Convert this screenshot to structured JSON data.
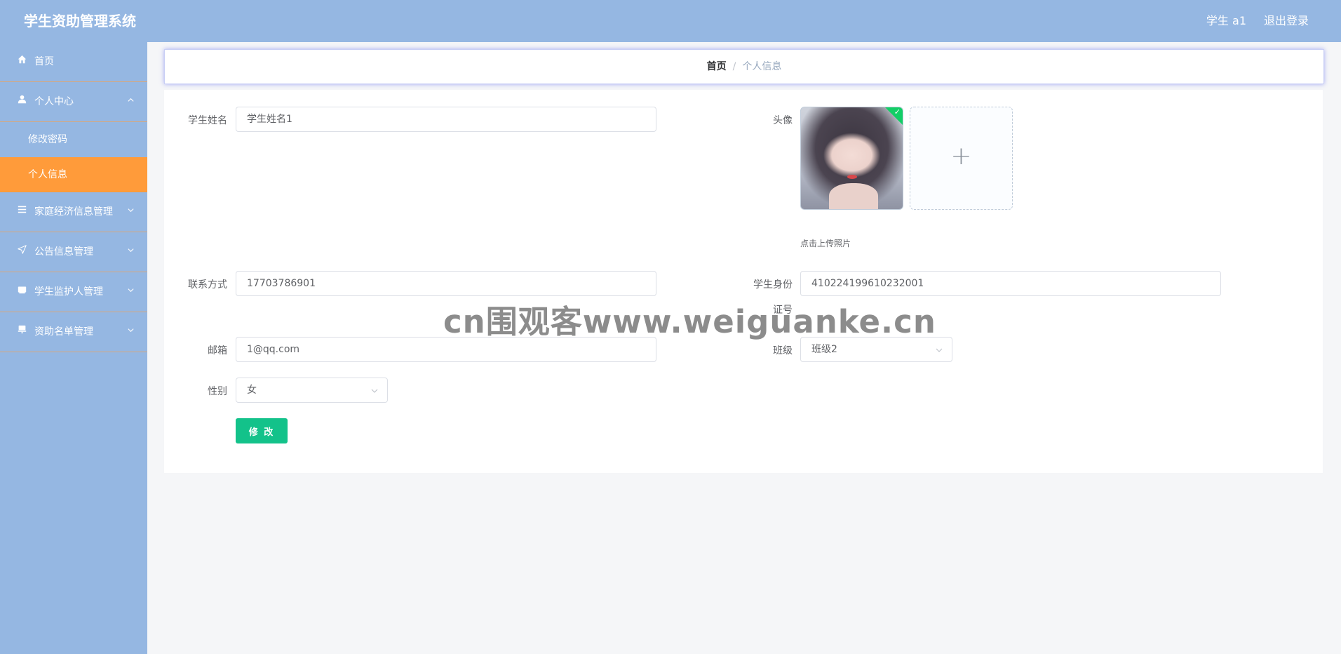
{
  "header": {
    "app_title": "学生资助管理系统",
    "user_name": "学生 a1",
    "logout_label": "退出登录"
  },
  "sidebar": {
    "items": [
      {
        "label": "首页",
        "icon": "home-icon"
      },
      {
        "label": "个人中心",
        "icon": "user-icon",
        "expanded": true,
        "children": [
          {
            "label": "修改密码"
          },
          {
            "label": "个人信息",
            "active": true
          }
        ]
      },
      {
        "label": "家庭经济信息管理",
        "icon": "list-icon"
      },
      {
        "label": "公告信息管理",
        "icon": "send-icon"
      },
      {
        "label": "学生监护人管理",
        "icon": "folder-icon"
      },
      {
        "label": "资助名单管理",
        "icon": "stamp-icon"
      }
    ]
  },
  "breadcrumb": {
    "home": "首页",
    "separator": "/",
    "current": "个人信息"
  },
  "form": {
    "student_name_label": "学生姓名",
    "student_name_value": "学生姓名1",
    "avatar_label": "头像",
    "upload_tip": "点击上传照片",
    "contact_label": "联系方式",
    "contact_value": "17703786901",
    "id_label_line1": "学生身份",
    "id_label_line2": "证号",
    "id_value": "410224199610232001",
    "email_label": "邮箱",
    "email_value": "1@qq.com",
    "class_label": "班级",
    "class_value": "班级2",
    "gender_label": "性别",
    "gender_value": "女",
    "submit_label": "修 改"
  },
  "watermark": "cn围观客www.weiguanke.cn",
  "colors": {
    "header_bg": "#95b7e2",
    "sidebar_bg": "#95b7e2",
    "active_menu_bg": "#ff9b3a",
    "submit_button_bg": "#13c28a"
  }
}
